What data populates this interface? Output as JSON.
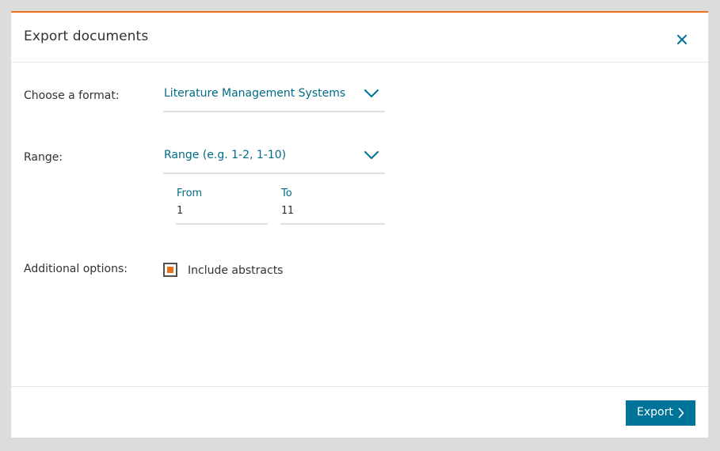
{
  "dialog": {
    "title": "Export documents"
  },
  "format": {
    "label": "Choose a format:",
    "selected": "Literature Management Systems"
  },
  "range": {
    "label": "Range:",
    "selected": "Range (e.g. 1-2, 1-10)",
    "from_label": "From",
    "from_value": "1",
    "to_label": "To",
    "to_value": "11"
  },
  "options": {
    "label": "Additional options:",
    "include_abstracts_label": "Include abstracts",
    "include_abstracts_checked": true
  },
  "footer": {
    "export_label": "Export"
  },
  "colors": {
    "accent": "#e9711c",
    "link": "#006b86",
    "button": "#007398"
  },
  "icons": {
    "close": "close-icon",
    "dropdown": "chevron-down-icon",
    "export": "chevron-right-icon"
  }
}
